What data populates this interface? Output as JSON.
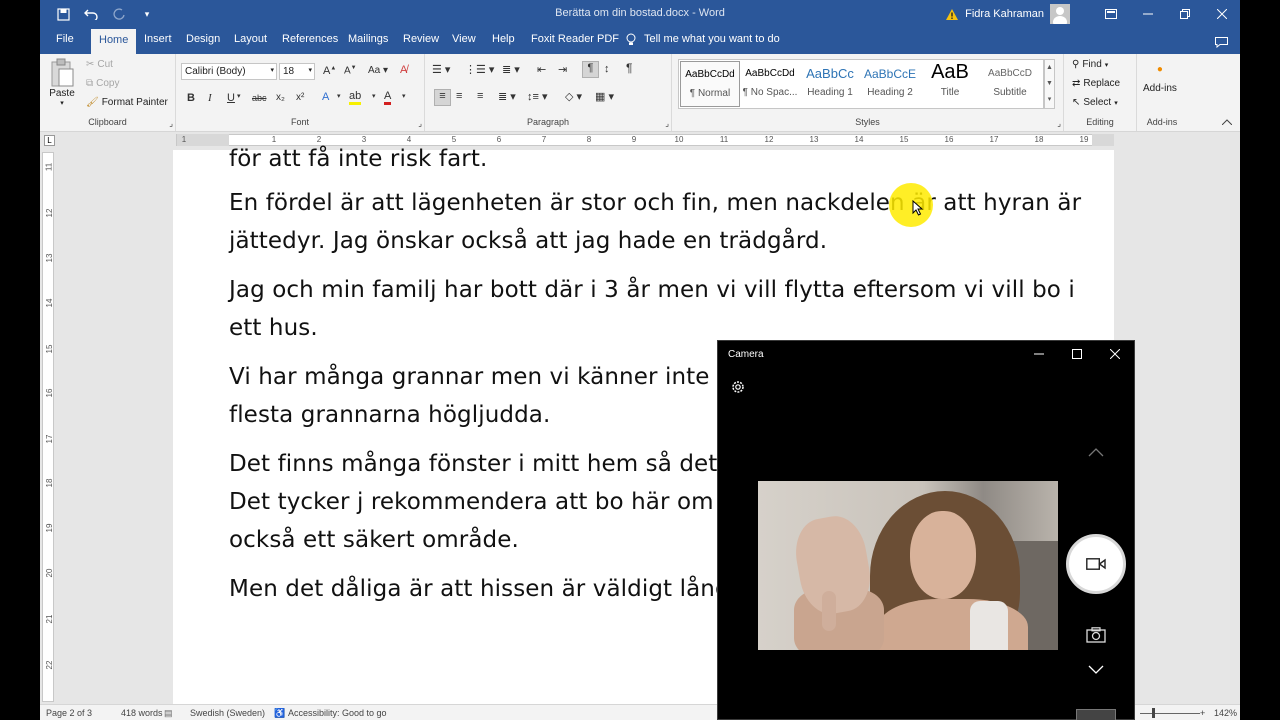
{
  "titlebar": {
    "document_title": "Berätta om din bostad.docx  -  Word",
    "user_name": "Fidra Kahraman",
    "icons": [
      "save-icon",
      "undo-icon",
      "redo-icon",
      "customize-qat-icon",
      "warning-icon",
      "ribbon-display-icon",
      "minimize-icon",
      "restore-icon",
      "close-icon"
    ]
  },
  "tabs": {
    "items": [
      "File",
      "Home",
      "Insert",
      "Design",
      "Layout",
      "References",
      "Mailings",
      "Review",
      "View",
      "Help",
      "Foxit Reader PDF"
    ],
    "active": "Home",
    "tell_me": "Tell me what you want to do"
  },
  "ribbon": {
    "clipboard": {
      "label": "Clipboard",
      "paste": "Paste",
      "cut": "Cut",
      "copy": "Copy",
      "format_painter": "Format Painter"
    },
    "font": {
      "label": "Font",
      "font_name": "Calibri (Body)",
      "font_size": "18",
      "bold": "B",
      "italic": "I",
      "underline": "U",
      "strike": "abc",
      "subscript": "x₂",
      "superscript": "x²"
    },
    "paragraph": {
      "label": "Paragraph"
    },
    "styles": {
      "label": "Styles",
      "items": [
        {
          "preview": "AaBbCcDd",
          "name": "¶ Normal"
        },
        {
          "preview": "AaBbCcDd",
          "name": "¶ No Spac..."
        },
        {
          "preview": "AaBbCc",
          "name": "Heading 1"
        },
        {
          "preview": "AaBbCcE",
          "name": "Heading 2"
        },
        {
          "preview": "AaB",
          "name": "Title"
        },
        {
          "preview": "AaBbCcD",
          "name": "Subtitle"
        }
      ]
    },
    "editing": {
      "label": "Editing",
      "find": "Find",
      "replace": "Replace",
      "select": "Select"
    },
    "addins": {
      "label": "Add-ins",
      "button": "Add-ins"
    }
  },
  "document": {
    "paragraphs": [
      "för att få inte risk fart.",
      "En fördel är att lägenheten är stor och fin, men nackdelen är att hyran är jättedyr. Jag önskar också att jag hade en trädgård.",
      "Jag och min familj har bott där i 3 år men vi vill flytta eftersom vi vill bo i ett hus.",
      "Vi har många grannar men vi känner inte o varandra i trapphuset. De flesta grannarna högljudda.",
      "Det finns många fönster i mitt hem så det ganska fin utsikt över kanalen. Det tycker j rekommendera att bo här om man har en utrymme. Det är också ett säkert område.",
      "Men det dåliga är att hissen är väldigt lång den i 5 minuter."
    ]
  },
  "statusbar": {
    "page": "Page 2 of 3",
    "words": "418 words",
    "language": "Swedish (Sweden)",
    "accessibility": "Accessibility: Good to go",
    "zoom": "142%"
  },
  "camera": {
    "title": "Camera",
    "icons": [
      "settings-icon",
      "chevron-up-icon",
      "video-record-icon",
      "camera-photo-icon",
      "chevron-down-icon"
    ]
  }
}
